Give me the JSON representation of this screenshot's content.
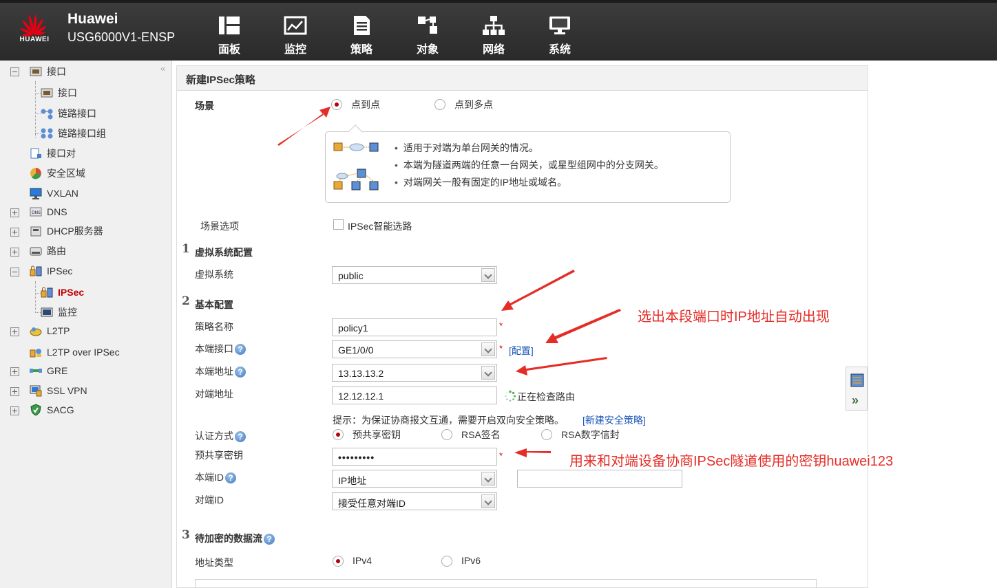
{
  "header": {
    "brand": "Huawei",
    "brand_mark": "HUAWEI",
    "product": "USG6000V1-ENSP",
    "nav": [
      {
        "label": "面板",
        "icon": "dashboard-icon"
      },
      {
        "label": "监控",
        "icon": "monitor-chart-icon"
      },
      {
        "label": "策略",
        "icon": "policy-document-icon"
      },
      {
        "label": "对象",
        "icon": "object-icon"
      },
      {
        "label": "网络",
        "icon": "network-icon"
      },
      {
        "label": "系统",
        "icon": "system-computer-icon"
      }
    ],
    "active_nav": "网络"
  },
  "sidebar": {
    "collapse": "«",
    "items": [
      {
        "label": "接口",
        "icon": "interface-icon"
      },
      {
        "label": "接口",
        "icon": "interface-icon"
      },
      {
        "label": "链路接口",
        "icon": "link-interface-icon"
      },
      {
        "label": "链路接口组",
        "icon": "link-group-icon"
      },
      {
        "label": "接口对",
        "icon": "interface-pair-icon"
      },
      {
        "label": "安全区域",
        "icon": "security-zone-icon"
      },
      {
        "label": "VXLAN",
        "icon": "vxlan-icon"
      },
      {
        "label": "DNS",
        "icon": "dns-icon"
      },
      {
        "label": "DHCP服务器",
        "icon": "dhcp-server-icon"
      },
      {
        "label": "路由",
        "icon": "route-icon"
      },
      {
        "label": "IPSec",
        "icon": "ipsec-icon"
      },
      {
        "label": "IPSec",
        "icon": "ipsec-icon"
      },
      {
        "label": "监控",
        "icon": "monitor-icon"
      },
      {
        "label": "L2TP",
        "icon": "l2tp-icon"
      },
      {
        "label": "L2TP over IPSec",
        "icon": "l2tp-ipsec-icon"
      },
      {
        "label": "GRE",
        "icon": "gre-icon"
      },
      {
        "label": "SSL VPN",
        "icon": "ssl-vpn-icon"
      },
      {
        "label": "SACG",
        "icon": "sacg-shield-icon"
      }
    ]
  },
  "panel": {
    "title": "新建IPSec策略",
    "scene": {
      "label": "场景",
      "options": [
        "点到点",
        "点到多点"
      ],
      "selected": "点到点",
      "info": [
        "适用于对端为单台网关的情况。",
        "本端为隧道两端的任意一台网关，或星型组网中的分支网关。",
        "对端网关一般有固定的IP地址或域名。"
      ]
    },
    "scene_options": {
      "label": "场景选项",
      "checkbox": "IPSec智能选路",
      "checked": false
    },
    "section1": {
      "num": "1",
      "title": "虚拟系统配置"
    },
    "vsys": {
      "label": "虚拟系统",
      "value": "public"
    },
    "section2": {
      "num": "2",
      "title": "基本配置"
    },
    "policy_name": {
      "label": "策略名称",
      "value": "policy1"
    },
    "local_if": {
      "label": "本端接口",
      "value": "GE1/0/0",
      "link": "[配置]"
    },
    "local_addr": {
      "label": "本端地址",
      "value": "13.13.13.2"
    },
    "peer_addr": {
      "label": "对端地址",
      "value": "12.12.12.1",
      "status": "正在检查路由"
    },
    "hint": "提示：为保证协商报文互通，需要开启双向安全策略。",
    "hint_link": "[新建安全策略]",
    "auth": {
      "label": "认证方式",
      "options": [
        "预共享密钥",
        "RSA签名",
        "RSA数字信封"
      ],
      "selected": "预共享密钥"
    },
    "psk": {
      "label": "预共享密钥",
      "value": "•••••••••"
    },
    "local_id": {
      "label": "本端ID",
      "value": "IP地址",
      "extra": ""
    },
    "peer_id": {
      "label": "对端ID",
      "value": "接受任意对端ID"
    },
    "section3": {
      "num": "3",
      "title": "待加密的数据流"
    },
    "addr_type": {
      "label": "地址类型",
      "options": [
        "IPv4",
        "IPv6"
      ],
      "selected": "IPv4"
    },
    "required_mark": "*",
    "help_mark": "?"
  },
  "annotations": {
    "note1": "选出本段端口时IP地址自动出现",
    "note2": "用来和对端设备协商IPSec隧道使用的密钥huawei123",
    "color": "#e52d27"
  },
  "mini_panel": {
    "expand": "»"
  }
}
